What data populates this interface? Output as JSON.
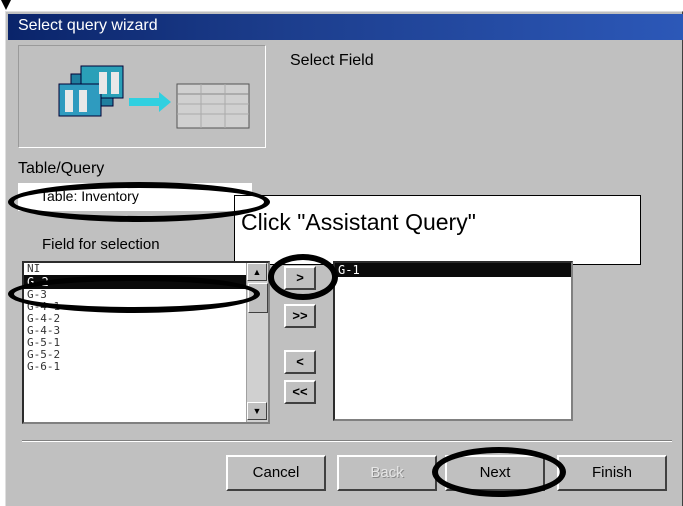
{
  "window": {
    "title": "Select query wizard"
  },
  "step": {
    "label": "Select Field"
  },
  "table_query": {
    "label": "Table/Query",
    "value": "Table: Inventory"
  },
  "callout": {
    "text": "Click \"Assistant Query\""
  },
  "available": {
    "label": "Field for selection",
    "items": [
      "NI",
      "G-2",
      "G-3",
      "G-4-1",
      "G-4-2",
      "G-4-3",
      "G-5-1",
      "G-5-2",
      "G-6-1"
    ],
    "selected_index": 1
  },
  "selected": {
    "items": [
      "G-1"
    ]
  },
  "move_buttons": {
    "add_one": ">",
    "add_all": ">>",
    "remove_one": "<",
    "remove_all": "<<"
  },
  "buttons": {
    "cancel": "Cancel",
    "back": "Back",
    "next": "Next",
    "finish": "Finish"
  },
  "colors": {
    "titlebar": "#0a246a",
    "dialog": "#c0c0c0",
    "annotation": "#000000"
  }
}
